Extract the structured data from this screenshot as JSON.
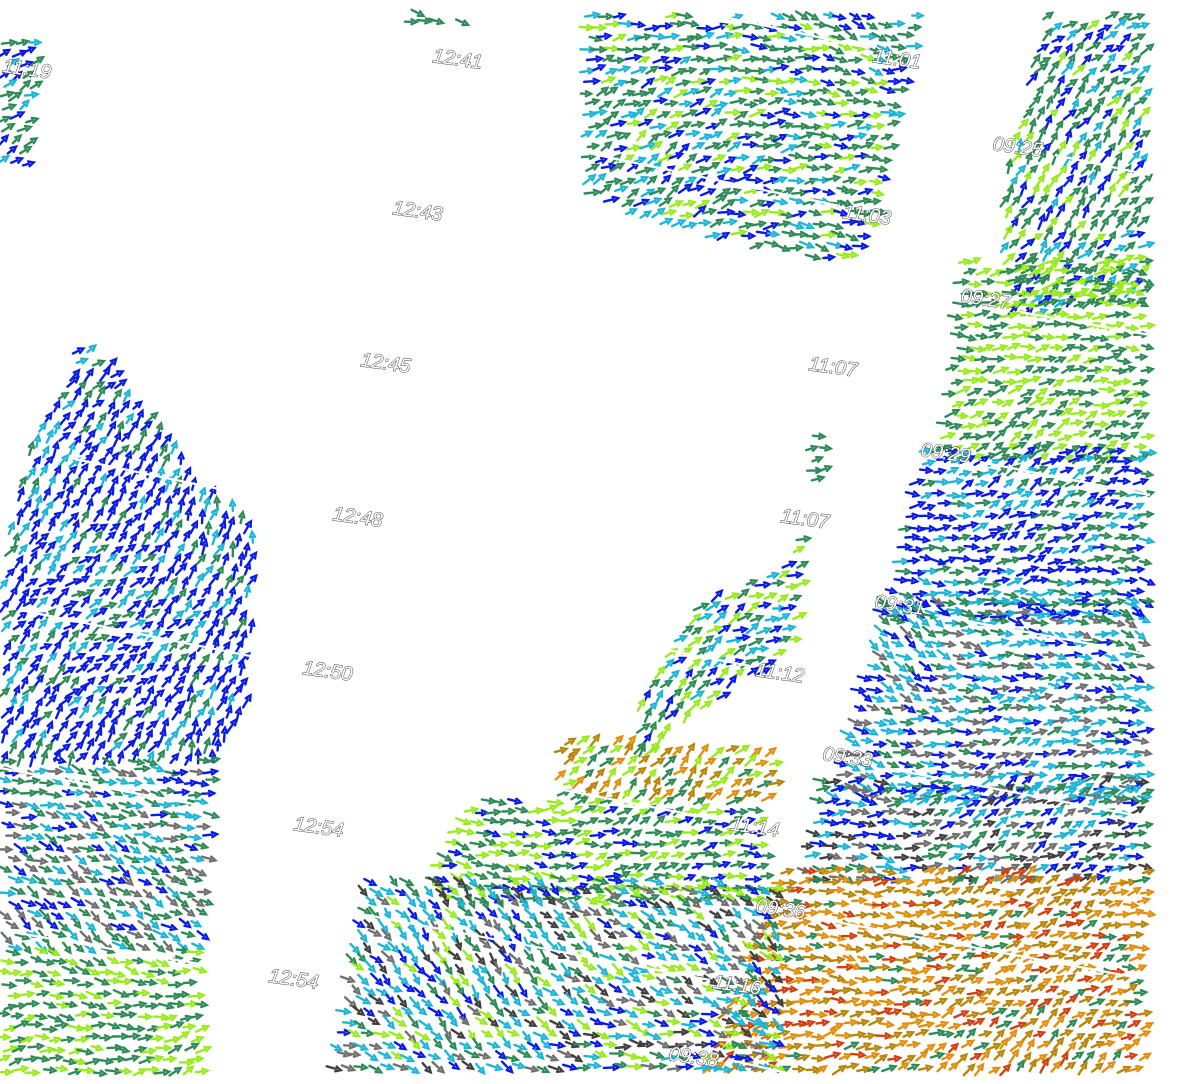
{
  "map": {
    "colors": {
      "blue": "#0b1be6",
      "cyan": "#1fb5d6",
      "green": "#2e8b57",
      "lime": "#9aea22",
      "orange": "#e09010",
      "gold": "#b8860b",
      "red": "#d04010",
      "gray": "#707070",
      "darkgray": "#404040"
    },
    "time_labels": [
      "11:19",
      "12:41",
      "12:43",
      "12:45",
      "12:48",
      "12:50",
      "12:54",
      "12:54",
      "11:01",
      "11:03",
      "11:07",
      "11:07",
      "11:12",
      "11:14",
      "11:16",
      "09:25",
      "09:27",
      "09:29",
      "09:31",
      "09:33",
      "09:36",
      "09:38"
    ]
  }
}
